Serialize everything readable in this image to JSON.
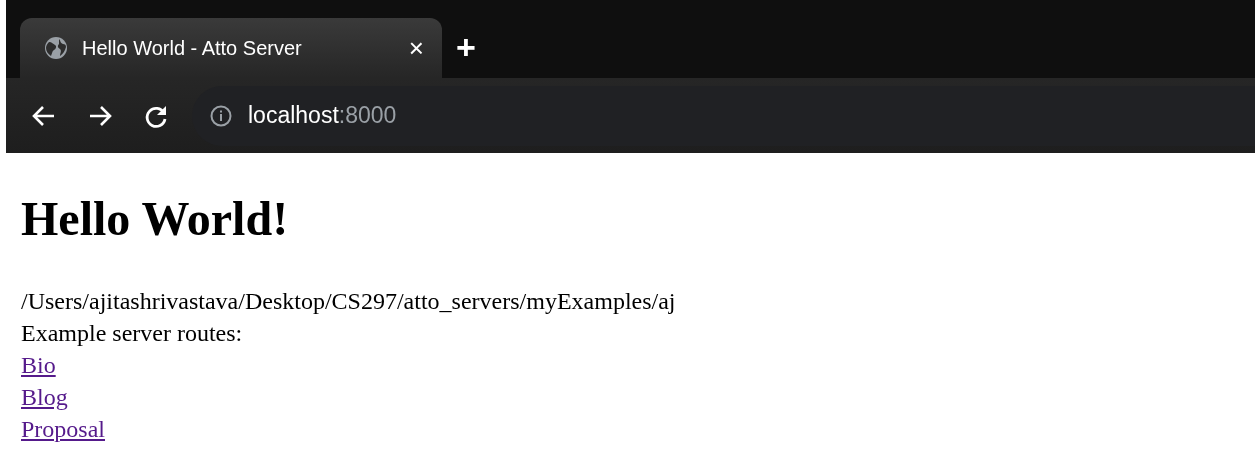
{
  "browser": {
    "tab": {
      "title": "Hello World - Atto Server",
      "close": "×"
    },
    "new_tab": "+",
    "address": {
      "host": "localhost",
      "port": ":8000"
    }
  },
  "page": {
    "heading": "Hello World!",
    "path": "/Users/ajitashrivastava/Desktop/CS297/atto_servers/myExamples/aj",
    "intro": "Example server routes:",
    "links": [
      "Bio",
      "Blog",
      "Proposal"
    ]
  }
}
